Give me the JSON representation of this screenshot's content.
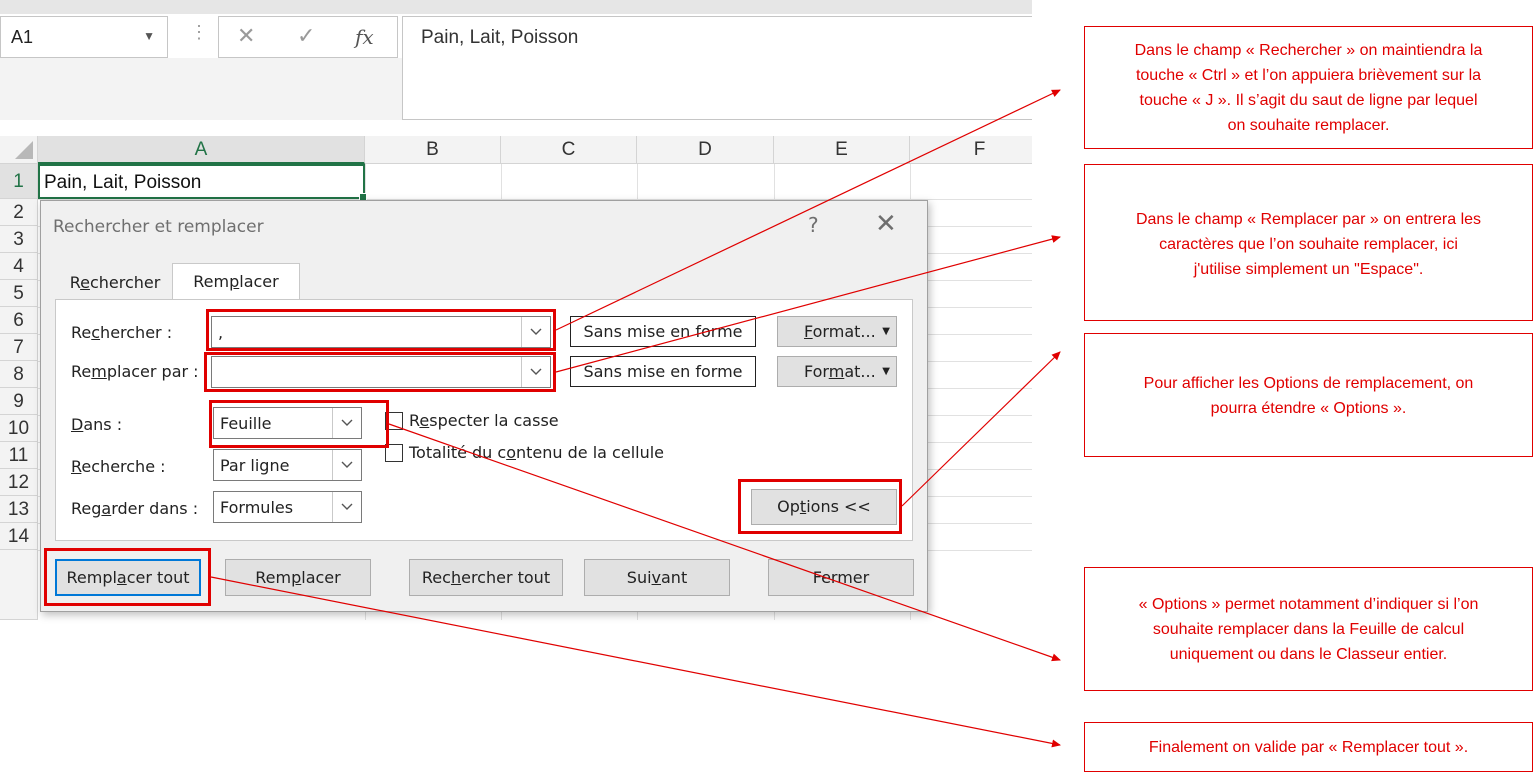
{
  "excel": {
    "name_box": "A1",
    "fx_symbol": "fx",
    "cancel_symbol": "✕",
    "enter_symbol": "✓",
    "formula_value": "Pain, Lait, Poisson",
    "columns": [
      "A",
      "B",
      "C",
      "D",
      "E",
      "F"
    ],
    "rows": [
      "1",
      "2",
      "3",
      "4",
      "5",
      "6",
      "7",
      "8",
      "9",
      "10",
      "11",
      "12",
      "13",
      "14"
    ],
    "cell_a1": "Pain, Lait, Poisson"
  },
  "dialog": {
    "title": "Rechercher et remplacer",
    "help": "?",
    "close": "✕",
    "tabs": [
      {
        "label": "Rechercher",
        "pre": "R",
        "u": "e",
        "post": "chercher",
        "active": false
      },
      {
        "label": "Remplacer",
        "pre": "Rem",
        "u": "p",
        "post": "lacer",
        "active": true
      }
    ],
    "find_label": {
      "pre": "Re",
      "u": "c",
      "post": "hercher :"
    },
    "find_value": ",",
    "replace_label": {
      "pre": "Re",
      "u": "m",
      "post": "placer par :"
    },
    "replace_value": "",
    "preview_find": "Sans mise en forme",
    "preview_replace": "Sans mise en forme",
    "format_find": {
      "pre": "",
      "u": "F",
      "post": "ormat..."
    },
    "format_replace": {
      "pre": "For",
      "u": "m",
      "post": "at..."
    },
    "within_label": {
      "pre": "",
      "u": "D",
      "post": "ans :"
    },
    "within_value": "Feuille",
    "search_label": {
      "pre": "",
      "u": "R",
      "post": "echerche :"
    },
    "search_value": "Par ligne",
    "lookin_label": {
      "pre": "Reg",
      "u": "a",
      "post": "rder dans :"
    },
    "lookin_value": "Formules",
    "match_case": {
      "pre": "R",
      "u": "e",
      "post": "specter la casse",
      "checked": false
    },
    "match_entire": {
      "pre": "Totalité du c",
      "u": "o",
      "post": "ntenu de la cellule",
      "checked": false
    },
    "options_button": {
      "pre": "Op",
      "u": "t",
      "post": "ions <<"
    },
    "buttons": {
      "replace_all": {
        "pre": "Rempl",
        "u": "a",
        "post": "cer tout"
      },
      "replace": {
        "pre": "Rem",
        "u": "p",
        "post": "lacer"
      },
      "find_all": {
        "pre": "Rec",
        "u": "h",
        "post": "ercher tout"
      },
      "next": {
        "pre": "Sui",
        "u": "v",
        "post": "ant"
      },
      "close": "Fermer"
    }
  },
  "annotations": [
    {
      "lines": [
        "Dans le champ « Rechercher » on maintiendra la",
        "touche « Ctrl » et l’on appuiera brièvement sur la",
        "touche « J ». Il s’agit du saut de ligne par lequel",
        "on souhaite remplacer."
      ]
    },
    {
      "lines": [
        "Dans le champ « Remplacer par » on entrera les",
        "caractères que l’on souhaite remplacer, ici",
        "j'utilise simplement un \"Espace\"."
      ]
    },
    {
      "lines": [
        "Pour afficher les Options de remplacement, on",
        "pourra étendre « Options »."
      ]
    },
    {
      "lines": [
        "« Options » permet notamment d’indiquer si l’on",
        "souhaite remplacer dans la Feuille de calcul",
        "uniquement ou dans le Classeur entier."
      ]
    },
    {
      "lines": [
        "Finalement on valide par « Remplacer tout »."
      ]
    }
  ],
  "colors": {
    "highlight": "#e00000",
    "excel_green": "#217346",
    "selected_button_border": "#0078d7"
  }
}
